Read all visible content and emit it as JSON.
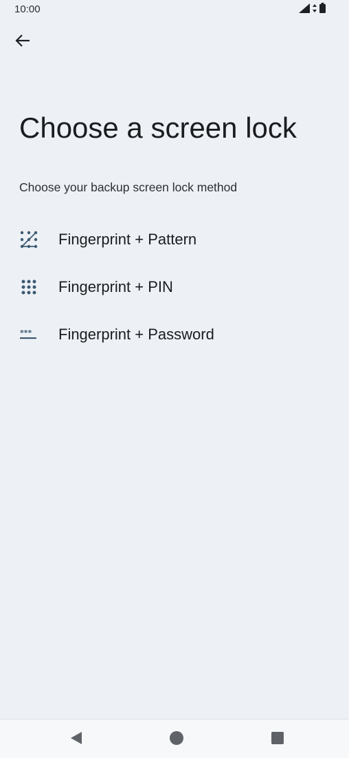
{
  "status_bar": {
    "time": "10:00",
    "icons": [
      "signal-icon",
      "data-arrows-icon",
      "battery-icon"
    ]
  },
  "header": {
    "back_icon": "arrow-back-icon"
  },
  "page": {
    "title": "Choose a screen lock",
    "subtitle": "Choose your backup screen lock method"
  },
  "options": [
    {
      "label": "Fingerprint + Pattern",
      "icon": "pattern-icon"
    },
    {
      "label": "Fingerprint + PIN",
      "icon": "pin-icon"
    },
    {
      "label": "Fingerprint + Password",
      "icon": "password-icon"
    }
  ],
  "nav_bar": {
    "icons": [
      "nav-back-icon",
      "nav-home-icon",
      "nav-recents-icon"
    ]
  },
  "colors": {
    "background": "#edf1f5",
    "icon_accent": "#3d5a73",
    "text": "#1b1c1f"
  }
}
